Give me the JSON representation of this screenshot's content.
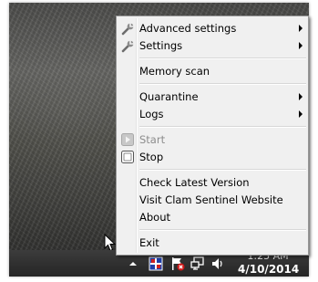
{
  "menu": {
    "items": {
      "advanced_settings": {
        "label": "Advanced settings",
        "icon": "wrench-icon",
        "submenu": true
      },
      "settings": {
        "label": "Settings",
        "icon": "wrench-icon",
        "submenu": true
      },
      "memory_scan": {
        "label": "Memory scan"
      },
      "quarantine": {
        "label": "Quarantine",
        "submenu": true
      },
      "logs": {
        "label": "Logs",
        "submenu": true
      },
      "start": {
        "label": "Start",
        "icon": "play-icon",
        "disabled": true
      },
      "stop": {
        "label": "Stop",
        "icon": "stop-icon"
      },
      "check_version": {
        "label": "Check Latest Version"
      },
      "visit_website": {
        "label": "Visit Clam Sentinel Website"
      },
      "about": {
        "label": "About"
      },
      "exit": {
        "label": "Exit"
      }
    }
  },
  "taskbar": {
    "tray_icons": [
      "show-hidden-icons-arrow",
      "clam-sentinel-tray-icon",
      "action-center-flag-icon",
      "network-icon",
      "volume-icon"
    ],
    "clock": {
      "time": "1:25 AM",
      "date": "4/10/2014"
    }
  },
  "colors": {
    "menu_background": "#f0f0f0",
    "menu_border": "#979797",
    "taskbar": "#2a2a2a",
    "disabled_text": "#8d8d8d"
  }
}
